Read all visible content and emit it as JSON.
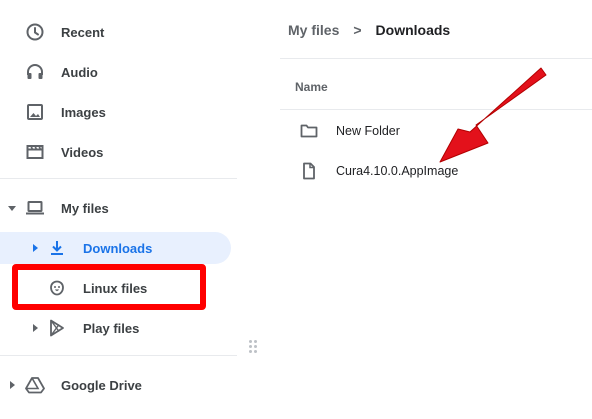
{
  "sidebar": {
    "recent": "Recent",
    "audio": "Audio",
    "images": "Images",
    "videos": "Videos",
    "my_files": "My files",
    "downloads": "Downloads",
    "linux_files": "Linux files",
    "play_files": "Play files",
    "google_drive": "Google Drive"
  },
  "breadcrumb": {
    "parent": "My files",
    "separator": ">",
    "current": "Downloads"
  },
  "table": {
    "name_header": "Name"
  },
  "files": [
    {
      "name": "New Folder",
      "icon": "folder-icon"
    },
    {
      "name": "Cura4.10.0.AppImage",
      "icon": "file-icon"
    }
  ],
  "colors": {
    "accent": "#1a73e8",
    "selected_bg": "#e8f0fe",
    "annotation_red": "#ff0000"
  }
}
